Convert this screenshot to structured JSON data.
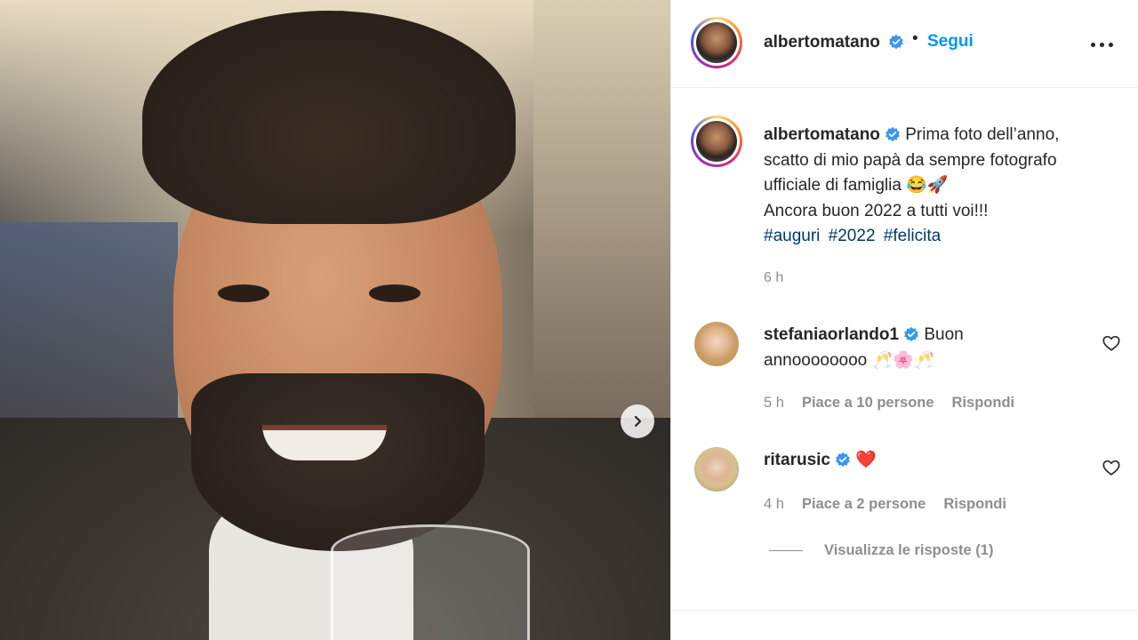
{
  "post": {
    "author": "albertomatano",
    "follow_label": "Segui",
    "dot": "•",
    "caption_lines": [
      "Prima foto dell’anno,",
      "scatto di mio papà da sempre fotografo",
      "ufficiale di famiglia 😂🚀",
      "Ancora buon 2022 a tutti voi!!!"
    ],
    "hashtags": [
      "#auguri",
      "#2022",
      "#felicita"
    ],
    "time": "6 h"
  },
  "comments": [
    {
      "user": "stefaniaorlando1",
      "text_line1": "Buon",
      "text_line2": "annoooooooo 🥂🌸🥂",
      "time": "5 h",
      "likes": "Piace a 10 persone",
      "reply": "Rispondi"
    },
    {
      "user": "ritarusic",
      "text_line1": "❤️",
      "time": "4 h",
      "likes": "Piace a 2 persone",
      "reply": "Rispondi",
      "view_replies": "Visualizza le risposte (1)"
    }
  ],
  "colors": {
    "link_blue": "#0095f6",
    "hashtag": "#00376b",
    "secondary_text": "#8e8e8e",
    "verified": "#3897f0"
  },
  "icons": {
    "carousel_next": "chevron-right-icon",
    "more": "more-horizontal-icon",
    "like": "heart-outline-icon",
    "verified": "verified-badge-icon"
  }
}
